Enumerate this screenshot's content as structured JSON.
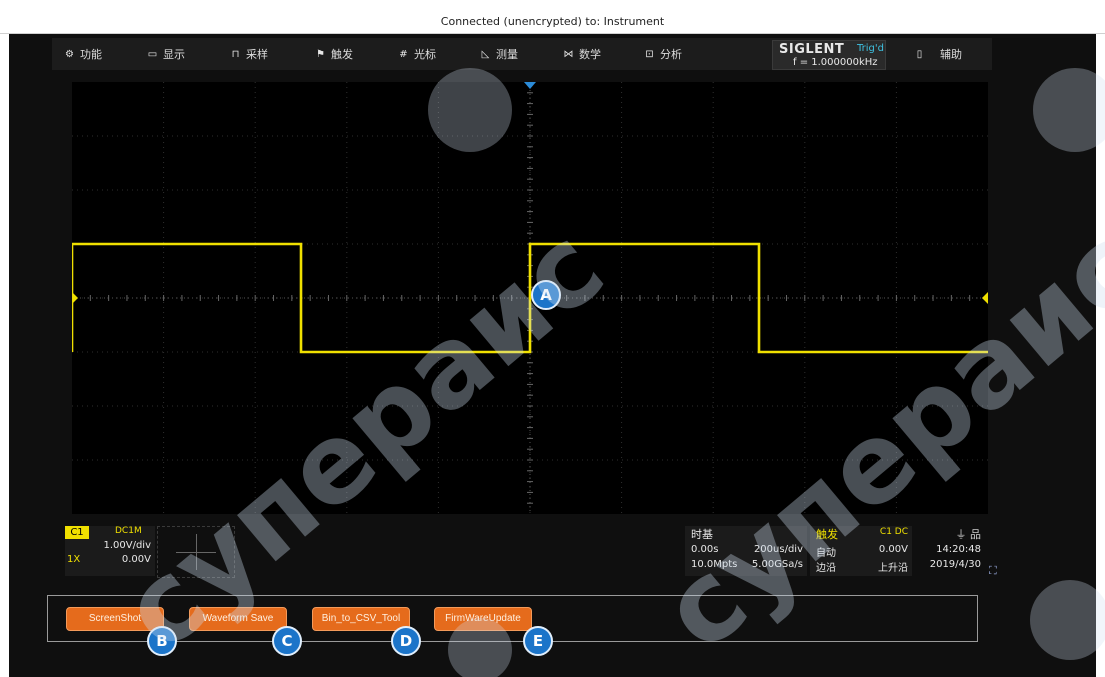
{
  "window": {
    "title": "Connected (unencrypted) to: Instrument"
  },
  "menu": {
    "items": [
      {
        "label": "功能",
        "icon": "gear-icon"
      },
      {
        "label": "显示",
        "icon": "display-icon"
      },
      {
        "label": "采样",
        "icon": "acquire-icon"
      },
      {
        "label": "触发",
        "icon": "trigger-flag-icon"
      },
      {
        "label": "光标",
        "icon": "cursor-icon"
      },
      {
        "label": "测量",
        "icon": "measure-icon"
      },
      {
        "label": "数学",
        "icon": "math-icon"
      },
      {
        "label": "分析",
        "icon": "analysis-icon"
      }
    ],
    "brand": "SIGLENT",
    "trig_status": "Trig'd",
    "frequency": "f = 1.000000kHz",
    "utility": "辅助"
  },
  "channel": {
    "name": "C1",
    "coupling": "DC1M",
    "scale": "1.00V/div",
    "probe": "1X",
    "offset": "0.00V",
    "color": "#f0e000"
  },
  "timebase": {
    "header": "时基",
    "delay": "0.00s",
    "scale": "200us/div",
    "depth": "10.0Mpts",
    "rate": "5.00GSa/s"
  },
  "trigger": {
    "header": "触发",
    "source": "C1 DC",
    "mode": "自动",
    "level": "0.00V",
    "type": "边沿",
    "slope": "上升沿"
  },
  "system": {
    "time": "14:20:48",
    "date": "2019/4/30"
  },
  "tools": [
    {
      "label": "ScreenShot",
      "marker": "B"
    },
    {
      "label": "Waveform Save",
      "marker": "C"
    },
    {
      "label": "Bin_to_CSV_Tool",
      "marker": "D"
    },
    {
      "label": "FirmWareUpdate",
      "marker": "E"
    }
  ],
  "markers": {
    "center": "A"
  },
  "waveform": {
    "type": "square",
    "level_high_div": 1.0,
    "level_low_div": -1.0,
    "transitions_div": [
      -5,
      -2.5,
      0,
      2.5,
      5
    ],
    "grid_divisions": {
      "x": 10,
      "y": 8
    }
  },
  "watermark": {
    "text": "супераис",
    "color": "#c8d8ec"
  }
}
